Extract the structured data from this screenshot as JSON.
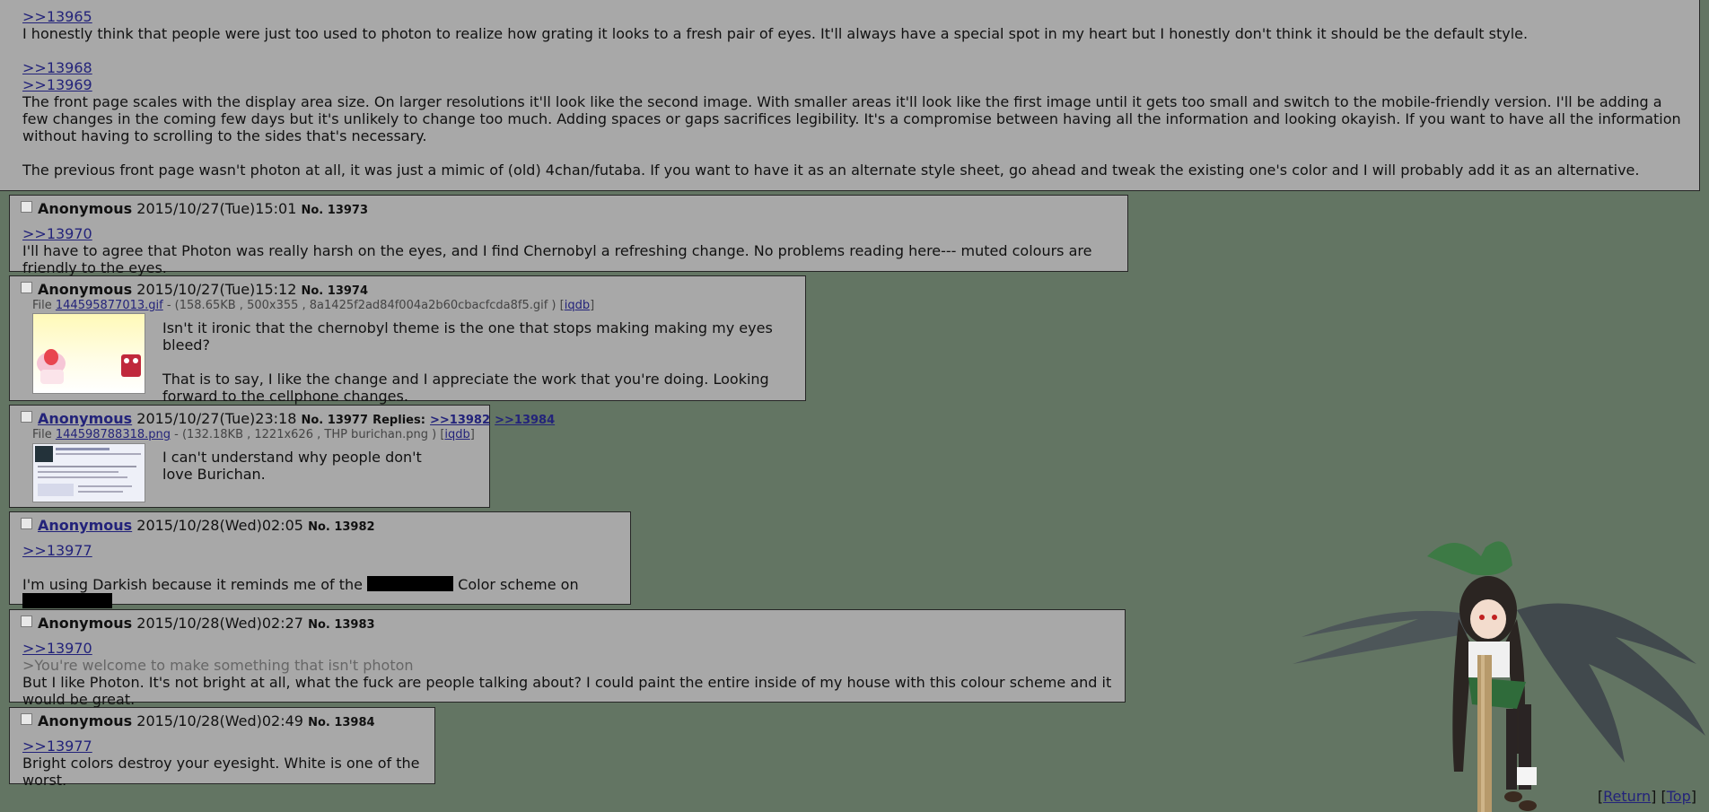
{
  "top_post": {
    "p1": {
      "link": ">>13965",
      "text": "I honestly think that people were just too used to photon to realize how grating it looks to a fresh pair of eyes. It'll always have a special spot in my heart but I honestly don't think it should be the default style."
    },
    "p2": {
      "link1": ">>13968",
      "link2": ">>13969",
      "text": "The front page scales with the display area size. On larger resolutions it'll look like the second image. With smaller areas it'll look like the first image until it gets too small and switch to the mobile-friendly version. I'll be adding a few changes in the coming few days but it's unlikely to change too much. Adding spaces or gaps sacrifices legibility. It's a compromise between having all the information and looking okayish. If you want to have all the information without having to scrolling to the sides that's necessary.",
      "text2": "The previous front page wasn't photon at all, it was just a mimic of (old) 4chan/futaba. If you want to have it as an alternate style sheet, go ahead and tweak the existing one's color and I will probably add it as an alternative."
    }
  },
  "posts": [
    {
      "name": "Anonymous",
      "date": "2015/10/27(Tue)15:01",
      "no": "No. 13973",
      "link": ">>13970",
      "text": "I'll have to agree that Photon was really harsh on the eyes, and I find Chernobyl a refreshing change. No problems reading here--- muted colours are friendly to the eyes."
    },
    {
      "name": "Anonymous",
      "date": "2015/10/27(Tue)15:12",
      "no": "No. 13974",
      "file_prefix": "File ",
      "file_name": "144595877013.gif",
      "file_meta": " - (158.65KB , 500x355 , 8a1425f2ad84f004a2b60cbacfcda8f5.gif ) [",
      "file_iqdb": "iqdb",
      "file_close": "]",
      "line1": "Isn't it ironic that the chernobyl theme is the one that stops making making my eyes bleed?",
      "line2": "That is to say, I like the change and I appreciate the work that you're doing. Looking forward to the cellphone changes."
    },
    {
      "name": "Anonymous",
      "date": "2015/10/27(Tue)23:18",
      "no": "No. 13977",
      "replies_label": "Replies:",
      "reply1": ">>13982",
      "reply2": ">>13984",
      "file_prefix": "File ",
      "file_name": "144598788318.png",
      "file_meta": " - (132.18KB , 1221x626 , THP burichan.png ) [",
      "file_iqdb": "iqdb",
      "file_close": "]",
      "text": "I can't understand why people don't love Burichan."
    },
    {
      "name": "Anonymous",
      "date": "2015/10/28(Wed)02:05",
      "no": "No. 13982",
      "link": ">>13977",
      "text_a": "I'm using Darkish because it reminds me of the ",
      "text_b": " Color scheme on "
    },
    {
      "name": "Anonymous",
      "date": "2015/10/28(Wed)02:27",
      "no": "No. 13983",
      "link": ">>13970",
      "greentext": ">You're welcome to make something that isn't photon",
      "text": "But I like Photon. It's not bright at all, what the fuck are people talking about? I could paint the entire inside of my house with this colour scheme and it would be great."
    },
    {
      "name": "Anonymous",
      "date": "2015/10/28(Wed)02:49",
      "no": "No. 13984",
      "link": ">>13977",
      "text": "Bright colors destroy your eyesight. White is one of the worst."
    }
  ],
  "footer": {
    "open1": "[",
    "return": "Return",
    "mid": "] [",
    "top": "Top",
    "close": "]"
  },
  "colors": {
    "background": "#637563",
    "post_bg": "#a8a8a8",
    "link": "#23237a"
  }
}
